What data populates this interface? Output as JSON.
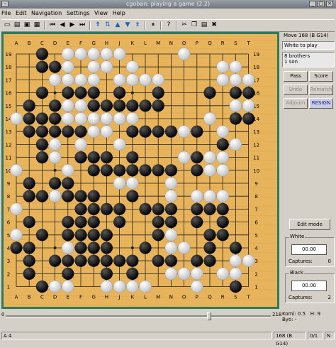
{
  "window": {
    "title": "cgoban: playing a game (2.2)"
  },
  "menu": [
    "File",
    "Edit",
    "Navigation",
    "Settings",
    "View",
    "Help"
  ],
  "panel": {
    "move": "Move 168 (B G14)",
    "to_play": "White to play",
    "info1": "8 brothers",
    "info2": "1 son",
    "pass": "Pass",
    "score": "Score",
    "undo": "Undo",
    "rematch": "Rematch",
    "adjourn": "Adjourn",
    "resign": "RESIGN",
    "edit_mode": "Edit mode",
    "white": {
      "label": "White",
      "time": "00.00",
      "captures_label": "Captures:",
      "captures": "0"
    },
    "black": {
      "label": "Black",
      "time": "00.00",
      "captures_label": "Captures:",
      "captures": "2"
    },
    "komi_label": "Komi:",
    "komi": "0.5",
    "hcap_label": "H:",
    "hcap": "9",
    "byo_label": "Byo:",
    "byo": "-"
  },
  "slider": {
    "min": "0",
    "max": "218",
    "value": 168
  },
  "status": {
    "coord": "A 4",
    "move": "168 (B G14)",
    "page": "0/1",
    "n": "N"
  },
  "board": {
    "size": 19,
    "cols": "ABCDEFGHJKLMNOPQRST",
    "board_color": "#e7b45c",
    "frame_color": "#2f7a5a",
    "last_move": "G14",
    "rows": [
      "..*.wwwOO....w.....",
      "..**w.ww.w......ww.",
      "...wwww.wwww....www",
      "..*.***.*..*...*.**",
      ".*.*ww******.....ww",
      "w***wwwwww.....w.**",
      ".*****ww.****w*.w..",
      "..*w.w..w.......*w.",
      "..*w.***.*...w*ww..",
      "w...w.*******.*ww..",
      ".*.**...ww..w......",
      ".**w***..*..w.www..",
      "w....****.***.***..",
      ".*..***.*..**.*.*..",
      "w.*.****...*w..**..",
      "**..w***..*.ww.*.*.",
      ".*.*******.**.**.ww",
      ".*..*..*.*..www.ww.",
      "..*ww..wwww...w..*."
    ]
  }
}
